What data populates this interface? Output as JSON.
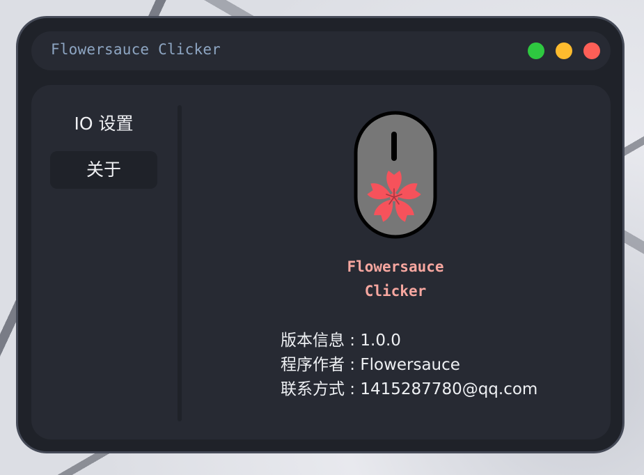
{
  "window": {
    "title": "Flowersauce Clicker"
  },
  "controls": {
    "maximize_color": "#2ec840",
    "minimize_color": "#fdbb2e",
    "close_color": "#fe5f57"
  },
  "sidebar": {
    "items": [
      {
        "label": "IO 设置",
        "active": false
      },
      {
        "label": "关于",
        "active": true
      }
    ]
  },
  "about": {
    "logo_icon": "sakura-mouse-icon",
    "app_name_line1": "Flowersauce",
    "app_name_line2": "Clicker",
    "version_label": "版本信息",
    "version_value": "1.0.0",
    "author_label": "程序作者",
    "author_value": "Flowersauce",
    "contact_label": "联系方式",
    "contact_value": "1415287780@qq.com"
  },
  "colors": {
    "accent": "#f7a7a0",
    "title_text": "#8ea6c3",
    "sakura": "#f6525b"
  }
}
